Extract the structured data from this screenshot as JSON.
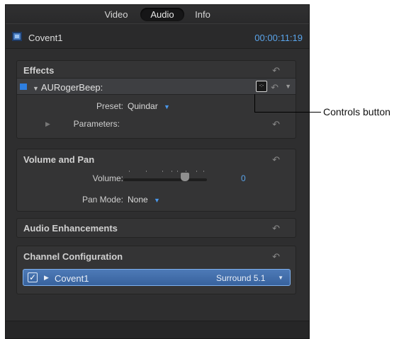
{
  "tabs": {
    "video": "Video",
    "audio": "Audio",
    "info": "Info"
  },
  "header": {
    "clip_name": "Covent1",
    "timecode": "00:00:11:19"
  },
  "effects": {
    "title": "Effects",
    "effect_name": "AURogerBeep:",
    "preset_label": "Preset:",
    "preset_value": "Quindar",
    "parameters_label": "Parameters:"
  },
  "volume_pan": {
    "title": "Volume and Pan",
    "volume_label": "Volume:",
    "volume_value": "0",
    "pan_mode_label": "Pan Mode:",
    "pan_mode_value": "None"
  },
  "audio_enhancements": {
    "title": "Audio Enhancements"
  },
  "channel_config": {
    "title": "Channel Configuration",
    "channel_name": "Covent1",
    "channel_mode": "Surround 5.1"
  },
  "callout": {
    "label": "Controls button"
  },
  "colors": {
    "accent": "#4a98ec",
    "timecode": "#5aa4ea",
    "panel_bg": "#2e2e2f"
  }
}
